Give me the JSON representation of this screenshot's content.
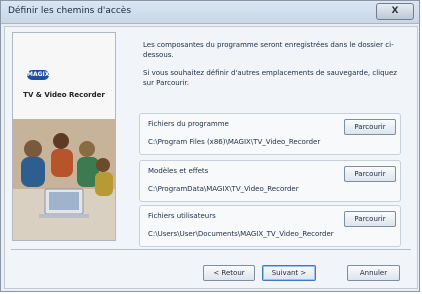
{
  "window": {
    "title": "Définir les chemins d'accès",
    "close_label": "X"
  },
  "left_panel": {
    "logo_text": "MAGIX",
    "product_name": "TV & Video Recorder"
  },
  "description": [
    "Les composantes du programme seront enregistrées dans le dossier ci-dessous.",
    "Si vous souhaitez définir d'autres emplacements de sauvegarde, cliquez sur Parcourir."
  ],
  "groups": [
    {
      "label": "Fichiers du programme",
      "path": "C:\\Program Files (x86)\\MAGIX\\TV_Video_Recorder",
      "button": "Parcourir"
    },
    {
      "label": "Modèles et effets",
      "path": "C:\\ProgramData\\MAGIX\\TV_Video_Recorder",
      "button": "Parcourir"
    },
    {
      "label": "Fichiers utilisateurs",
      "path": "C:\\Users\\User\\Documents\\MAGIX_TV_Video_Recorder",
      "button": "Parcourir"
    }
  ],
  "footer": {
    "back": "< Retour",
    "next": "Suivant >",
    "cancel": "Annuler"
  }
}
